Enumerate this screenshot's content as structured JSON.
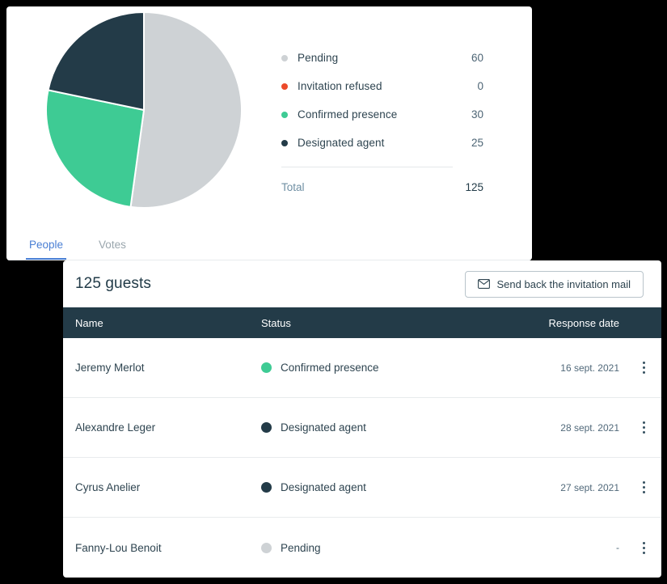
{
  "colors": {
    "pending": "#ced2d5",
    "refused": "#ec4a2a",
    "confirmed": "#3ecb94",
    "agent": "#233b48",
    "accent_blue": "#4a7fd4",
    "header_bar": "#233b48"
  },
  "chart_data": {
    "type": "pie",
    "title": "",
    "categories": [
      "Pending",
      "Invitation refused",
      "Confirmed presence",
      "Designated agent"
    ],
    "values": [
      60,
      0,
      30,
      25
    ],
    "colors": [
      "#ced2d5",
      "#ec4a2a",
      "#3ecb94",
      "#233b48"
    ],
    "total_label": "Total",
    "total_value": 125,
    "legend_position": "right",
    "start_angle_deg": 0,
    "direction": "clockwise"
  },
  "legend": {
    "rows": [
      {
        "label": "Pending",
        "value": "60",
        "color": "#ced2d5",
        "icon": "status-dot-pending-icon"
      },
      {
        "label": "Invitation refused",
        "value": "0",
        "color": "#ec4a2a",
        "icon": "status-dot-refused-icon"
      },
      {
        "label": "Confirmed presence",
        "value": "30",
        "color": "#3ecb94",
        "icon": "status-dot-confirmed-icon"
      },
      {
        "label": "Designated agent",
        "value": "25",
        "color": "#233b48",
        "icon": "status-dot-agent-icon"
      }
    ],
    "total_label": "Total",
    "total_value": "125"
  },
  "tabs": [
    {
      "label": "People",
      "active": true
    },
    {
      "label": "Votes",
      "active": false
    }
  ],
  "table": {
    "title": "125 guests",
    "resend_button": {
      "label": "Send back the invitation mail",
      "icon": "envelope-icon"
    },
    "columns": [
      "Name",
      "Status",
      "Response date"
    ],
    "rows": [
      {
        "name": "Jeremy Merlot",
        "status": "Confirmed presence",
        "status_color": "#3ecb94",
        "date": "16 sept. 2021"
      },
      {
        "name": "Alexandre Leger",
        "status": "Designated agent",
        "status_color": "#233b48",
        "date": "28 sept. 2021"
      },
      {
        "name": "Cyrus Anelier",
        "status": "Designated agent",
        "status_color": "#233b48",
        "date": "27 sept. 2021"
      },
      {
        "name": "Fanny-Lou Benoit",
        "status": "Pending",
        "status_color": "#ced2d5",
        "date": "-"
      }
    ],
    "row_menu_icon": "kebab-menu-icon"
  }
}
